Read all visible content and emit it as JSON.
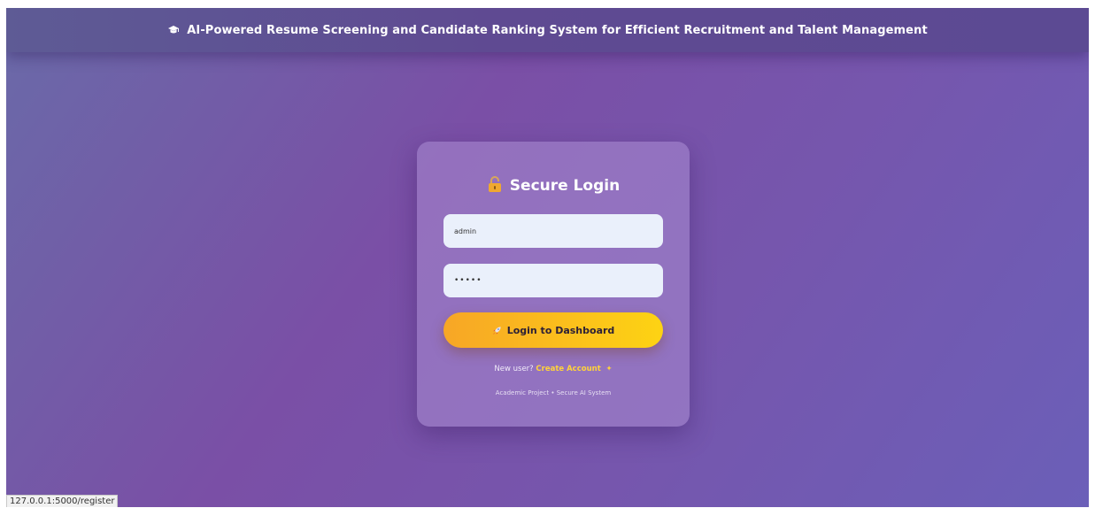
{
  "header": {
    "icon": "graduation-cap-icon",
    "title": "AI-Powered Resume Screening and Candidate Ranking System for Efficient Recruitment and Talent Management"
  },
  "login": {
    "icon": "lock-icon",
    "title": "Secure Login",
    "username_value": "admin",
    "password_value": "•••••",
    "button_icon": "rocket-icon",
    "button_label": "Login to Dashboard",
    "signup_prompt": "New user?",
    "signup_link": "Create Account",
    "signup_icon": "sparkle-icon",
    "footer": "Academic Project • Secure AI System"
  },
  "status_bar": {
    "url": "127.0.0.1:5000/register"
  },
  "colors": {
    "accent": "#fbbf1c",
    "link": "#ffd23a",
    "background_start": "#6a6aa8",
    "background_end": "#6b5fb8"
  }
}
